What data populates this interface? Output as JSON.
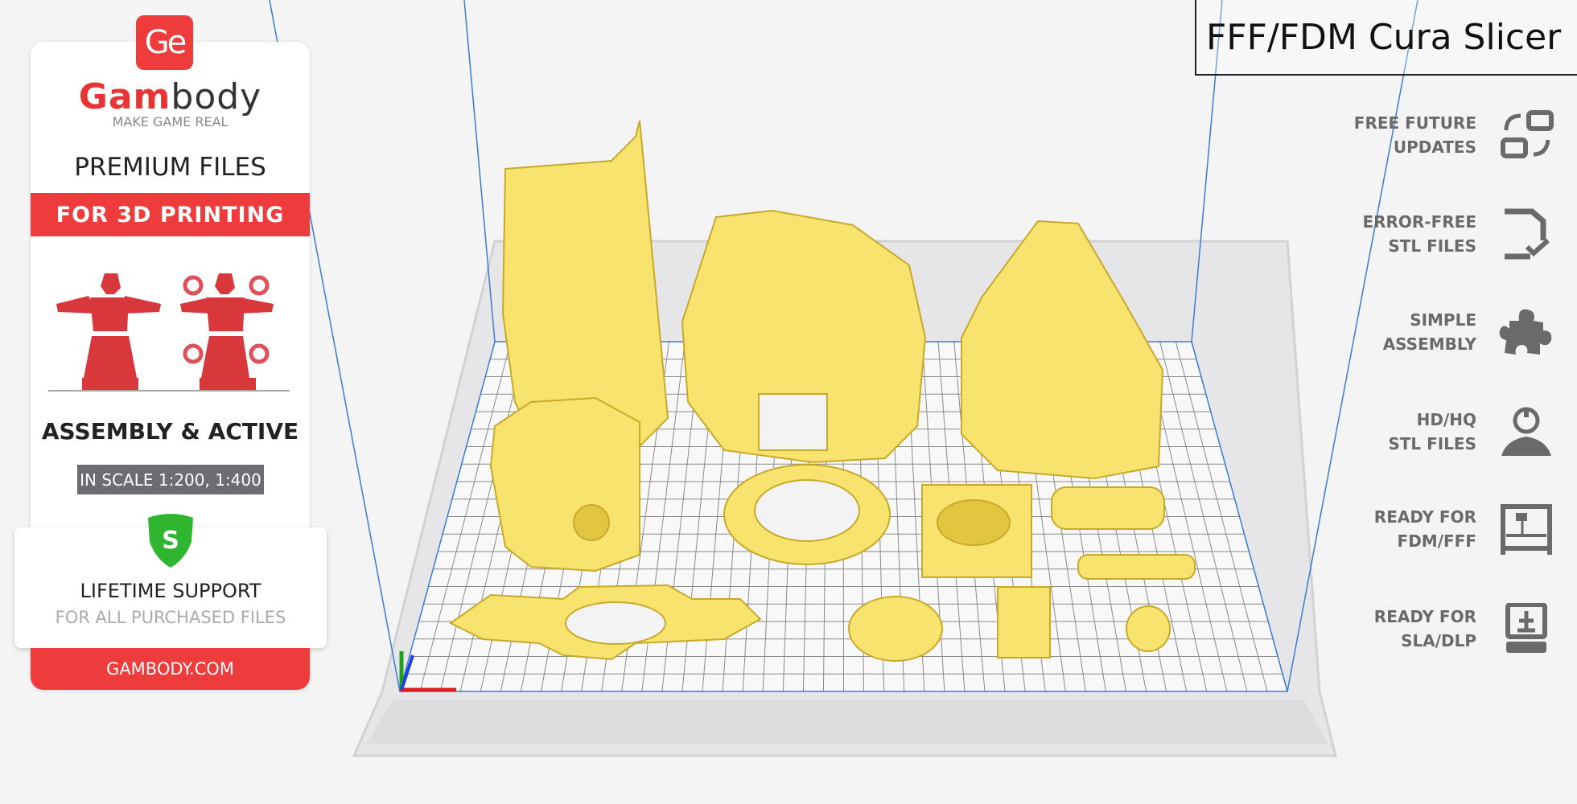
{
  "brand": {
    "logo_mark": "Ge",
    "name_red": "Gam",
    "name_dark": "body",
    "tagline": "MAKE GAME REAL",
    "accent": "#ee3b3b"
  },
  "left_card": {
    "premium": "PREMIUM FILES",
    "band": "FOR 3D PRINTING",
    "assembly": "ASSEMBLY & ACTIVE",
    "scale": "IN SCALE 1:200, 1:400",
    "shield_letter": "S",
    "lifetime": "LIFETIME SUPPORT",
    "lifetime_sub": "FOR ALL PURCHASED FILES",
    "website": "GAMBODY.COM"
  },
  "title": "FFF/FDM Cura Slicer",
  "features": [
    {
      "line1": "FREE FUTURE",
      "line2": "UPDATES",
      "icon": "update-icon"
    },
    {
      "line1": "ERROR-FREE",
      "line2": "STL FILES",
      "icon": "file-check-icon"
    },
    {
      "line1": "SIMPLE",
      "line2": "ASSEMBLY",
      "icon": "puzzle-icon"
    },
    {
      "line1": "HD/HQ",
      "line2": "STL FILES",
      "icon": "ironman-icon"
    },
    {
      "line1": "READY FOR",
      "line2": "FDM/FFF",
      "icon": "fdm-printer-icon"
    },
    {
      "line1": "READY FOR",
      "line2": "SLA/DLP",
      "icon": "sla-printer-icon"
    }
  ],
  "colors": {
    "model": "#f7e36e",
    "model_shade": "#e3c640",
    "build_volume": "#3a7bd5",
    "grid": "#8a8a8a"
  }
}
